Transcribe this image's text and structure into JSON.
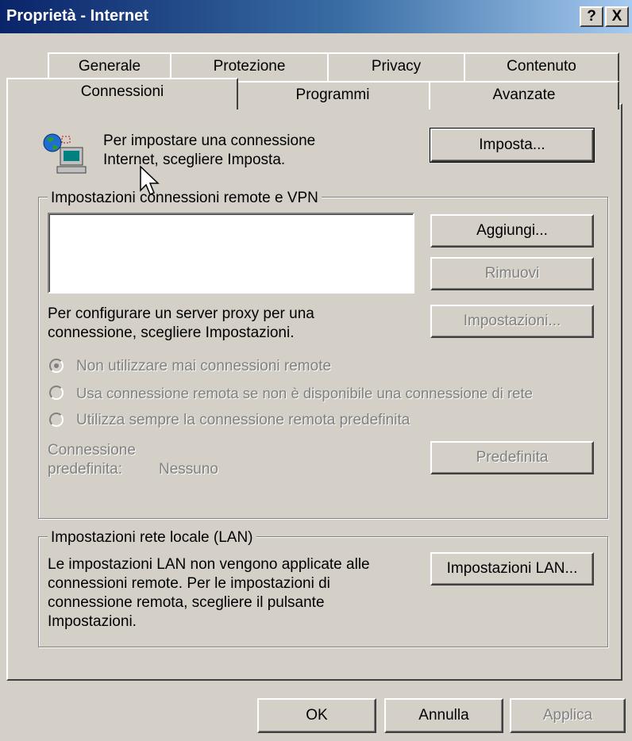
{
  "window": {
    "title": "Proprietà - Internet",
    "help_button": "?",
    "close_button": "X"
  },
  "tabs_row1": [
    "Generale",
    "Protezione",
    "Privacy",
    "Contenuto"
  ],
  "tabs_row2": [
    "Connessioni",
    "Programmi",
    "Avanzate"
  ],
  "active_tab": "Connessioni",
  "setup": {
    "text_line1": "Per impostare una connessione",
    "text_line2": "Internet, scegliere Imposta.",
    "button": "Imposta..."
  },
  "remote_group": {
    "legend": "Impostazioni connessioni remote e VPN",
    "list_items": [],
    "add_button": "Aggiungi...",
    "remove_button": "Rimuovi",
    "proxy_text_line1": "Per configurare un server proxy per una",
    "proxy_text_line2": "connessione, scegliere Impostazioni.",
    "settings_button": "Impostazioni...",
    "radio_options": [
      {
        "label": "Non utilizzare mai connessioni remote",
        "selected": true
      },
      {
        "label": "Usa connessione remota se non è disponibile una connessione di rete",
        "selected": false
      },
      {
        "label": "Utilizza sempre la connessione remota predefinita",
        "selected": false
      }
    ],
    "default_label_line1": "Connessione",
    "default_label_line2": "predefinita:",
    "default_value": "Nessuno",
    "default_button": "Predefinita"
  },
  "lan_group": {
    "legend": "Impostazioni rete locale (LAN)",
    "text_lines": [
      "Le impostazioni LAN non vengono applicate alle",
      "connessioni remote. Per le impostazioni di",
      "connessione remota, scegliere il pulsante",
      "Impostazioni."
    ],
    "button": "Impostazioni LAN..."
  },
  "footer": {
    "ok": "OK",
    "cancel": "Annulla",
    "apply": "Applica"
  },
  "icons": {
    "connection_wizard": "globe-computer-icon",
    "cursor": "mouse-pointer-icon"
  }
}
